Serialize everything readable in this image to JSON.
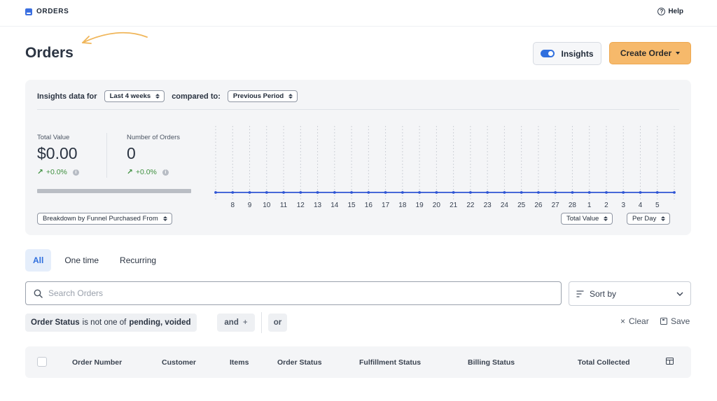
{
  "topbar": {
    "brand": "ORDERS",
    "help_label": "Help"
  },
  "page": {
    "title": "Orders"
  },
  "header_actions": {
    "insights_label": "Insights",
    "insights_on": true,
    "create_label": "Create Order"
  },
  "insights": {
    "data_for_label": "Insights data for",
    "period_value": "Last 4 weeks",
    "compared_label": "compared to:",
    "compare_value": "Previous Period",
    "metrics": [
      {
        "label": "Total Value",
        "value": "$0.00",
        "delta": "+0.0%"
      },
      {
        "label": "Number of Orders",
        "value": "0",
        "delta": "+0.0%"
      }
    ],
    "breakdown_value": "Breakdown by Funnel Purchased From",
    "metric_select": "Total Value",
    "interval_select": "Per Day"
  },
  "chart_data": {
    "type": "line",
    "categories": [
      "",
      "8",
      "9",
      "10",
      "11",
      "12",
      "13",
      "14",
      "15",
      "16",
      "17",
      "18",
      "19",
      "20",
      "21",
      "22",
      "23",
      "24",
      "25",
      "26",
      "27",
      "28",
      "1",
      "2",
      "3",
      "4",
      "5",
      ""
    ],
    "series": [
      {
        "values": [
          0,
          0,
          0,
          0,
          0,
          0,
          0,
          0,
          0,
          0,
          0,
          0,
          0,
          0,
          0,
          0,
          0,
          0,
          0,
          0,
          0,
          0,
          0,
          0,
          0,
          0,
          0,
          0
        ]
      }
    ],
    "color": "#2f55d4"
  },
  "tabs": [
    {
      "label": "All",
      "active": true
    },
    {
      "label": "One time",
      "active": false
    },
    {
      "label": "Recurring",
      "active": false
    }
  ],
  "search": {
    "placeholder": "Search Orders"
  },
  "sort": {
    "label": "Sort by"
  },
  "filters": {
    "field": "Order Status",
    "operator": "is not one of",
    "values": "pending, voided",
    "and_label": "and",
    "or_label": "or",
    "clear_label": "Clear",
    "save_label": "Save"
  },
  "table": {
    "columns": [
      "Order Number",
      "Customer",
      "Items",
      "Order Status",
      "Fulfillment Status",
      "Billing Status",
      "Total Collected"
    ]
  },
  "colors": {
    "accent": "#2f6fde",
    "primary_button": "#f6b96b",
    "panel_bg": "#f4f5f7",
    "positive": "#3d8f3d",
    "annotation": "#f0b65a"
  }
}
